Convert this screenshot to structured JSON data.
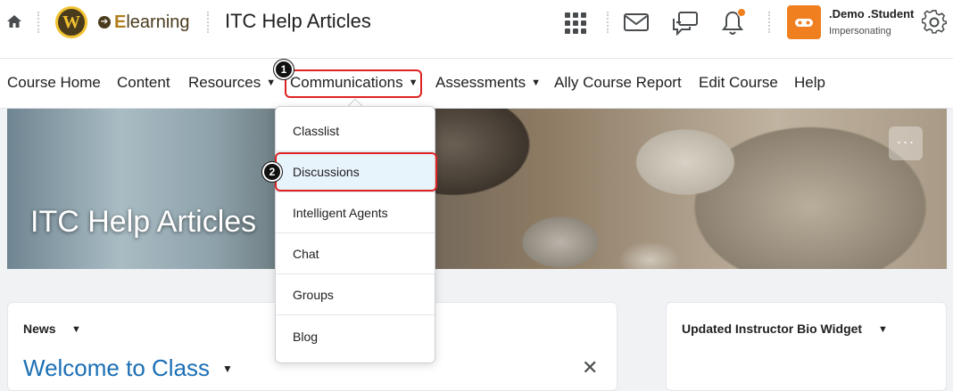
{
  "header": {
    "brand_name": "Elearning",
    "brand_initial": "E",
    "brand_rest": "learning",
    "logo_letter": "W",
    "course_title": "ITC Help Articles",
    "user_name": ".Demo .Student",
    "user_status": "Impersonating",
    "icons": [
      "home-icon",
      "waffle-grid-icon",
      "message-icon",
      "chat-bubble-icon",
      "bell-icon",
      "gear-icon"
    ],
    "notification_color": "#f07f1f"
  },
  "nav": {
    "items": [
      {
        "label": "Course Home",
        "has_menu": false
      },
      {
        "label": "Content",
        "has_menu": false
      },
      {
        "label": "Resources",
        "has_menu": true
      },
      {
        "label": "Communications",
        "has_menu": true
      },
      {
        "label": "Assessments",
        "has_menu": true
      },
      {
        "label": "Ally Course Report",
        "has_menu": false
      },
      {
        "label": "Edit Course",
        "has_menu": false
      },
      {
        "label": "Help",
        "has_menu": false
      }
    ],
    "chevron": "⌄"
  },
  "annotations": {
    "step1": "1",
    "step2": "2",
    "highlight_color": "#dd2222"
  },
  "dropdown": {
    "items": [
      {
        "label": "Classlist"
      },
      {
        "label": "Discussions"
      },
      {
        "label": "Intelligent Agents"
      },
      {
        "label": "Chat"
      },
      {
        "label": "Groups"
      },
      {
        "label": "Blog"
      }
    ]
  },
  "banner": {
    "title": "ITC Help Articles",
    "more": "···"
  },
  "news_widget": {
    "heading": "News",
    "post_title": "Welcome to Class",
    "close": "✕"
  },
  "bio_widget": {
    "heading": "Updated Instructor Bio Widget"
  }
}
